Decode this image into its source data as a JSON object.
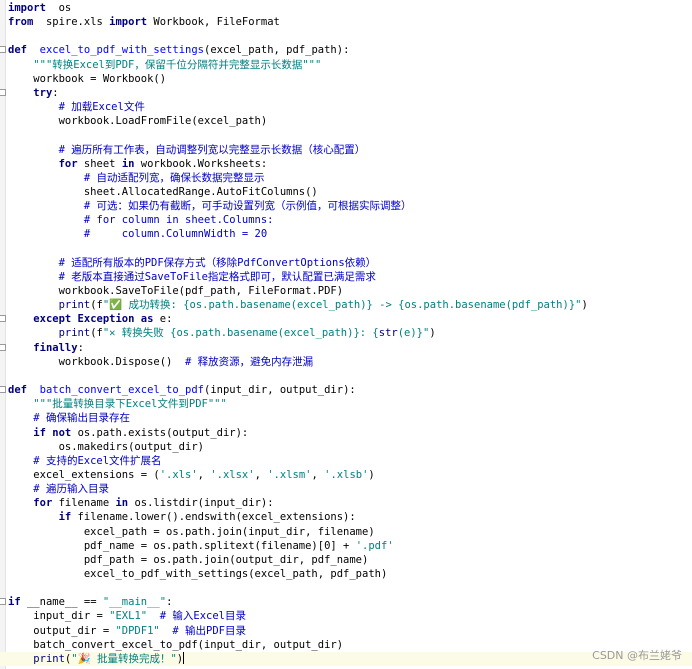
{
  "editor": {
    "lines": [
      [
        [
          "kw",
          "import"
        ],
        [
          "",
          "  os"
        ]
      ],
      [
        [
          "kw",
          "from"
        ],
        [
          "",
          "  spire.xls "
        ],
        [
          "kw",
          "import"
        ],
        [
          "",
          " Workbook, FileFormat"
        ]
      ],
      [],
      [
        [
          "kw",
          "def"
        ],
        [
          "",
          "  "
        ],
        [
          "fn",
          "excel_to_pdf_with_settings"
        ],
        [
          "",
          "(excel_path, pdf_path):"
        ]
      ],
      [
        [
          "",
          "    "
        ],
        [
          "str",
          "\"\"\"转换Excel到PDF，保留千位分隔符并完整显示长数据\"\"\""
        ]
      ],
      [
        [
          "",
          "    workbook = Workbook()"
        ]
      ],
      [
        [
          "",
          "    "
        ],
        [
          "kw",
          "try"
        ],
        [
          "",
          ":"
        ]
      ],
      [
        [
          "",
          "        "
        ],
        [
          "cm",
          "# 加载Excel文件"
        ]
      ],
      [
        [
          "",
          "        workbook.LoadFromFile(excel_path)"
        ]
      ],
      [],
      [
        [
          "",
          "        "
        ],
        [
          "cm",
          "# 遍历所有工作表，自动调整列宽以完整显示长数据（核心配置）"
        ]
      ],
      [
        [
          "",
          "        "
        ],
        [
          "kw",
          "for"
        ],
        [
          "",
          " sheet "
        ],
        [
          "kw",
          "in"
        ],
        [
          "",
          " workbook.Worksheets:"
        ]
      ],
      [
        [
          "",
          "            "
        ],
        [
          "cm",
          "# 自动适配列宽，确保长数据完整显示"
        ]
      ],
      [
        [
          "",
          "            sheet.AllocatedRange.AutoFitColumns()"
        ]
      ],
      [
        [
          "",
          "            "
        ],
        [
          "cm",
          "# 可选：如果仍有截断，可手动设置列宽（示例值，可根据实际调整）"
        ]
      ],
      [
        [
          "",
          "            "
        ],
        [
          "cm",
          "# for column in sheet.Columns:"
        ]
      ],
      [
        [
          "",
          "            "
        ],
        [
          "cm",
          "#     column.ColumnWidth = 20"
        ]
      ],
      [],
      [
        [
          "",
          "        "
        ],
        [
          "cm",
          "# 适配所有版本的PDF保存方式（移除PdfConvertOptions依赖）"
        ]
      ],
      [
        [
          "",
          "        "
        ],
        [
          "cm",
          "# 老版本直接通过SaveToFile指定格式即可，默认配置已满足需求"
        ]
      ],
      [
        [
          "",
          "        workbook.SaveToFile(pdf_path, FileFormat.PDF)"
        ]
      ],
      [
        [
          "",
          "        "
        ],
        [
          "bi",
          "print"
        ],
        [
          "",
          "(f"
        ],
        [
          "str",
          "\"✅ 成功转换: {os.path.basename(excel_path)} -> {os.path.basename(pdf_path)}\""
        ],
        [
          "",
          ")"
        ]
      ],
      [
        [
          "",
          "    "
        ],
        [
          "kw",
          "except"
        ],
        [
          "",
          ""
        ],
        [
          "kw",
          " Exception"
        ],
        [
          "",
          " "
        ],
        [
          "kw",
          "as"
        ],
        [
          "",
          " e:"
        ]
      ],
      [
        [
          "",
          "        "
        ],
        [
          "bi",
          "print"
        ],
        [
          "",
          "(f"
        ],
        [
          "str",
          "\"✕ 转换失败 {os.path.basename(excel_path)}: {"
        ],
        [
          "bi",
          "str"
        ],
        [
          "str",
          "(e)}\""
        ],
        [
          "",
          ")"
        ]
      ],
      [
        [
          "",
          "    "
        ],
        [
          "kw",
          "finally"
        ],
        [
          "",
          ":"
        ]
      ],
      [
        [
          "",
          "        workbook.Dispose()  "
        ],
        [
          "cm",
          "# 释放资源，避免内存泄漏"
        ]
      ],
      [],
      [
        [
          "kw",
          "def"
        ],
        [
          "",
          "  "
        ],
        [
          "fn",
          "batch_convert_excel_to_pdf"
        ],
        [
          "",
          "(input_dir, output_dir):"
        ]
      ],
      [
        [
          "",
          "    "
        ],
        [
          "str",
          "\"\"\"批量转换目录下Excel文件到PDF\"\"\""
        ]
      ],
      [
        [
          "",
          "    "
        ],
        [
          "cm",
          "# 确保输出目录存在"
        ]
      ],
      [
        [
          "",
          "    "
        ],
        [
          "kw",
          "if"
        ],
        [
          "",
          " "
        ],
        [
          "kw",
          "not"
        ],
        [
          "",
          " os.path.exists(output_dir):"
        ]
      ],
      [
        [
          "",
          "        os.makedirs(output_dir)"
        ]
      ],
      [
        [
          "",
          "    "
        ],
        [
          "cm",
          "# 支持的Excel文件扩展名"
        ]
      ],
      [
        [
          "",
          "    excel_extensions = ("
        ],
        [
          "str",
          "'.xls'"
        ],
        [
          "",
          ", "
        ],
        [
          "str",
          "'.xlsx'"
        ],
        [
          "",
          ", "
        ],
        [
          "str",
          "'.xlsm'"
        ],
        [
          "",
          ", "
        ],
        [
          "str",
          "'.xlsb'"
        ],
        [
          "",
          ")"
        ]
      ],
      [
        [
          "",
          "    "
        ],
        [
          "cm",
          "# 遍历输入目录"
        ]
      ],
      [
        [
          "",
          "    "
        ],
        [
          "kw",
          "for"
        ],
        [
          "",
          " filename "
        ],
        [
          "kw",
          "in"
        ],
        [
          "",
          " os.listdir(input_dir):"
        ]
      ],
      [
        [
          "",
          "        "
        ],
        [
          "kw",
          "if"
        ],
        [
          "",
          " filename.lower().endswith(excel_extensions):"
        ]
      ],
      [
        [
          "",
          "            excel_path = os.path.join(input_dir, filename)"
        ]
      ],
      [
        [
          "",
          "            pdf_name = os.path.splitext(filename)[0] + "
        ],
        [
          "str",
          "'.pdf'"
        ]
      ],
      [
        [
          "",
          "            pdf_path = os.path.join(output_dir, pdf_name)"
        ]
      ],
      [
        [
          "",
          "            excel_to_pdf_with_settings(excel_path, pdf_path)"
        ]
      ],
      [],
      [
        [
          "kw",
          "if"
        ],
        [
          "",
          " __name__ == "
        ],
        [
          "str",
          "\"__main__\""
        ],
        [
          "",
          ":"
        ]
      ],
      [
        [
          "",
          "    input_dir = "
        ],
        [
          "str",
          "\"EXL1\""
        ],
        [
          "",
          "  "
        ],
        [
          "cm",
          "# 输入Excel目录"
        ]
      ],
      [
        [
          "",
          "    output_dir = "
        ],
        [
          "str",
          "\"DPDF1\""
        ],
        [
          "",
          "  "
        ],
        [
          "cm",
          "# 输出PDF目录"
        ]
      ],
      [
        [
          "",
          "    batch_convert_excel_to_pdf(input_dir, output_dir)"
        ]
      ],
      [
        [
          "",
          "    "
        ],
        [
          "bi",
          "print"
        ],
        [
          "",
          "("
        ],
        [
          "str",
          "\"🎉 批量转换完成！\""
        ],
        [
          "",
          ")"
        ]
      ]
    ],
    "current_line": 46,
    "fold_lines": [
      3,
      6,
      22,
      24,
      27,
      42
    ]
  },
  "watermark": "CSDN @布兰姥爷"
}
